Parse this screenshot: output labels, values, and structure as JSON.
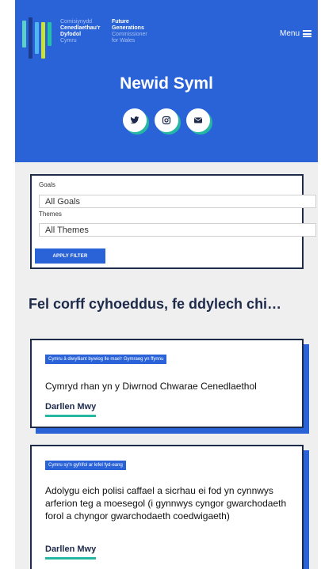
{
  "header": {
    "logo": {
      "cy": [
        "Comisiynydd",
        "Cenedlaethau'r",
        "Dyfodol",
        "Cymru"
      ],
      "en": [
        "Future",
        "Generations",
        "Commissioner",
        "for Wales"
      ]
    },
    "menu_label": "Menu",
    "page_title": "Newid Syml",
    "socials": [
      "twitter-icon",
      "instagram-icon",
      "email-icon"
    ]
  },
  "filter": {
    "goals_label": "Goals",
    "goals_value": "All Goals",
    "themes_label": "Themes",
    "themes_value": "All Themes",
    "button_label": "APPLY FILTER"
  },
  "section_heading": "Fel corff cyhoeddus, fe ddylech chi…",
  "cards": [
    {
      "tag": "Cymru â diwylliant bywiog lle mae'r Gymraeg yn ffynnu",
      "title": "Cymryd rhan yn y Diwrnod Chwarae Cenedlaethol",
      "link": "Darllen Mwy"
    },
    {
      "tag": "Cymru sy'n gyfrifol ar lefel fyd-eang",
      "title": "Adolygu eich polisi caffael a sicrhau ei fod yn cynnwys arferion teg a moesegol (i gynnwys cyngor gwarchodaeth forol a chyngor gwarchodaeth coedwigaeth)",
      "link": "Darllen Mwy"
    }
  ],
  "colors": {
    "brand_blue": "#2a63d8",
    "navy": "#1e2a4a",
    "teal": "#25b7a4"
  }
}
